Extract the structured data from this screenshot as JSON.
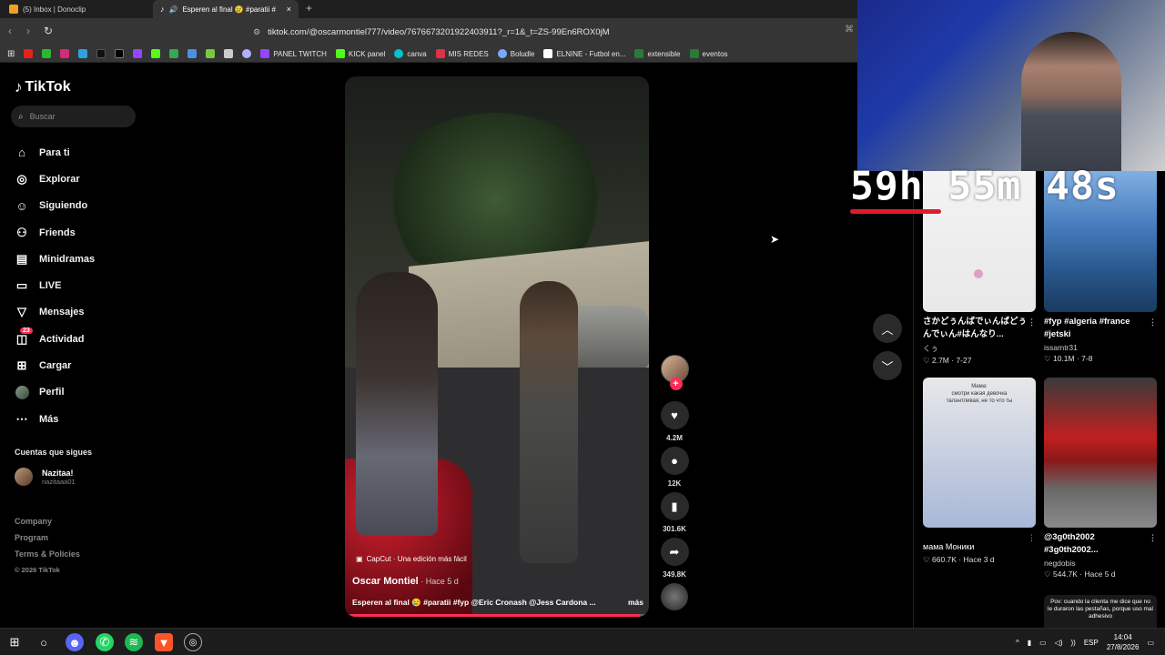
{
  "browser": {
    "tabs": [
      {
        "label": "(5) Inbox | Donoclip"
      },
      {
        "label": "Esperen al final 😢 #paratii #",
        "close": "×"
      }
    ],
    "new_tab": "+",
    "url": "tiktok.com/@oscarmontiel777/video/7676673201922403911?_r=1&_t=ZS-99En6ROX0jM",
    "bookmarks": [
      "PANEL TWITCH",
      "KICK panel",
      "canva",
      "MIS REDES",
      "Boludle",
      "ELNINE - Futbol en...",
      "extensible",
      "eventos"
    ]
  },
  "sidebar": {
    "logo": "TikTok",
    "search_placeholder": "Buscar",
    "nav": [
      {
        "label": "Para ti",
        "icon": "home-icon"
      },
      {
        "label": "Explorar",
        "icon": "compass-icon"
      },
      {
        "label": "Siguiendo",
        "icon": "following-icon"
      },
      {
        "label": "Friends",
        "icon": "friends-icon"
      },
      {
        "label": "Minidramas",
        "icon": "minidramas-icon"
      },
      {
        "label": "LIVE",
        "icon": "live-icon"
      },
      {
        "label": "Mensajes",
        "icon": "messages-icon"
      },
      {
        "label": "Actividad",
        "icon": "activity-icon",
        "badge": "23"
      },
      {
        "label": "Cargar",
        "icon": "upload-icon"
      },
      {
        "label": "Perfil",
        "icon": "profile-icon"
      },
      {
        "label": "Más",
        "icon": "more-icon"
      }
    ],
    "following_title": "Cuentas que sigues",
    "following": [
      {
        "name": "Nazitaa!",
        "handle": "nazitaaa01"
      }
    ],
    "footer": [
      "Company",
      "Program",
      "Terms & Policies"
    ],
    "copyright": "© 2026 TikTok"
  },
  "video": {
    "capcut": "CapCut · Una edición más fácil",
    "author": "Oscar Montiel",
    "time": " · Hace 5 d",
    "caption": "Esperen al final 😢 #paratii #fyp @Eric Cronash @Jess Cardona ...",
    "more": "más",
    "progress": 0.97
  },
  "actions": {
    "likes": "4.2M",
    "comments": "12K",
    "saves": "301.6K",
    "shares": "349.8K"
  },
  "recommendations": [
    {
      "title": "さかどぅんばでぃんばどぅんでぃん#はんなり...",
      "user": "くぅ",
      "likes": "2.7M",
      "date": "7-27"
    },
    {
      "title": "#fyp #algeria #france #jetski",
      "user": "issamtr31",
      "likes": "10.1M",
      "date": "7-8"
    },
    {
      "title": "мама Моники",
      "user": "",
      "likes": "660.7K",
      "date": "Hace 3 d",
      "overlay": "Мама:\nсмотри какая девочка\nталантливая, не то что ты"
    },
    {
      "title": "@3g0th2002 #3g0th2002...",
      "user": "negdobis",
      "likes": "544.7K",
      "date": "Hace 5 d"
    },
    {
      "overlay": "Pov: cuando la clienta me dice que no le duraron las pestañas, porque uso mal adhesivo"
    }
  ],
  "stream_overlay": {
    "timer": "59h 55m 48s"
  },
  "taskbar": {
    "lang": "ESP",
    "time": "14:04",
    "date": "27/8/2026"
  }
}
